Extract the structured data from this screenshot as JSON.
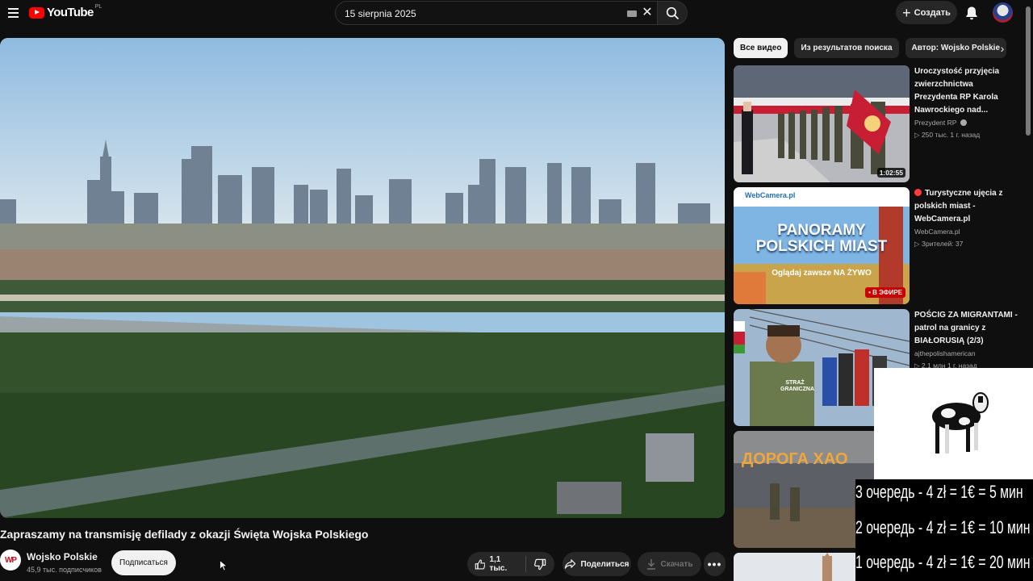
{
  "header": {
    "logo_text": "YouTube",
    "logo_region": "PL",
    "search_value": "15 sierpnia 2025",
    "create_label": "Создать"
  },
  "video": {
    "title": "Zapraszamy na transmisję defilady z okazji Święta Wojska Polskiego",
    "channel_name": "Wojsko Polskie",
    "channel_subscribers": "45,9 тыс. подписчиков",
    "channel_avatar_text": "WP",
    "subscribe_label": "Подписаться",
    "like_count": "1,1 тыс.",
    "share_label": "Поделиться",
    "download_label": "Скачать"
  },
  "sidebar": {
    "chips": [
      {
        "label": "Все видео",
        "active": true
      },
      {
        "label": "Из результатов поиска",
        "active": false
      },
      {
        "label": "Автор: Wojsko Polskie",
        "active": false
      }
    ],
    "recommendations": [
      {
        "title": "Uroczystość przyjęcia zwierzchnictwa Prezydenta RP Karola Nawrockiego nad...",
        "channel": "Prezydent RP",
        "stats": "▷ 250 тыс.  1 г. назад",
        "duration": "1:02:55"
      },
      {
        "title": "Turystyczne ujęcia z polskich miast - WebCamera.pl",
        "channel": "WebCamera.pl",
        "stats": "▷ Зрителей: 37",
        "badge": "• В ЭФИРЕ",
        "thumb_text": "PANORAMY POLSKICH MIAST",
        "thumb_sub": "Oglądaj zawsze NA ŻYWO",
        "thumb_brand": "WebCamera.pl"
      },
      {
        "title": "POŚCIG ZA MIGRANTAMI - patrol na granicy z BIAŁORUSIĄ (2/3)",
        "channel": "ajthepolishamerican",
        "stats": "▷ 2,1 млн  1 г. назад",
        "thumb_text": "STRAŻ GRANICZNA"
      },
      {
        "title": "",
        "channel": "",
        "stats": "",
        "thumb_text": "ДОРОГА ХАО"
      }
    ]
  },
  "overlay": {
    "queue_lines": [
      "3 очередь - 4 zł = 1€ = 5 мин",
      "2 очередь - 4 zł = 1€ = 10 мин",
      "1 очередь - 4 zł = 1€ = 20 мин"
    ]
  }
}
